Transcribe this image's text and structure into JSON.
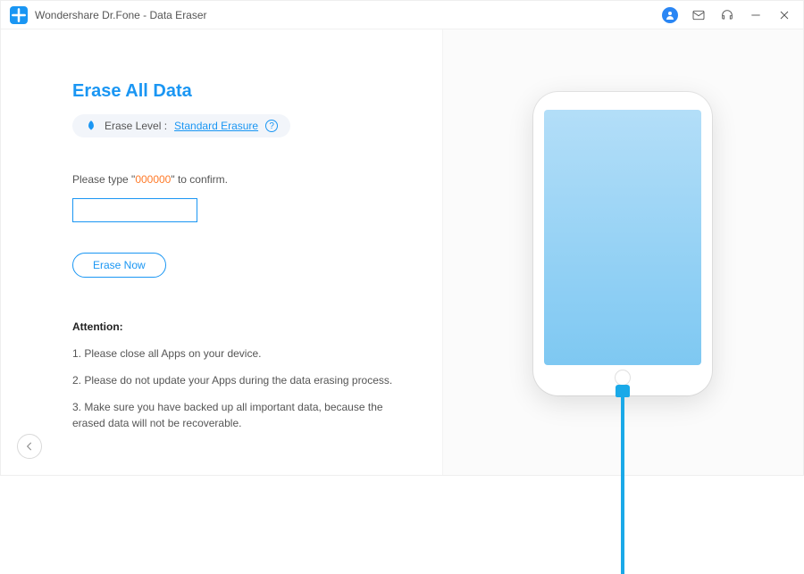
{
  "titlebar": {
    "title": "Wondershare Dr.Fone - Data Eraser"
  },
  "heading": "Erase All Data",
  "erase_level": {
    "label": "Erase Level :",
    "value": "Standard Erasure"
  },
  "confirm": {
    "instruction_prefix": "Please type \"",
    "code": "000000",
    "instruction_suffix": "\" to confirm.",
    "input_value": ""
  },
  "erase_button_label": "Erase Now",
  "attention": {
    "title": "Attention:",
    "items": [
      "1. Please close all Apps on your device.",
      "2. Please do not update your Apps during the data erasing process.",
      "3. Make sure you have backed up all important data, because the erased data will not be recoverable."
    ]
  }
}
